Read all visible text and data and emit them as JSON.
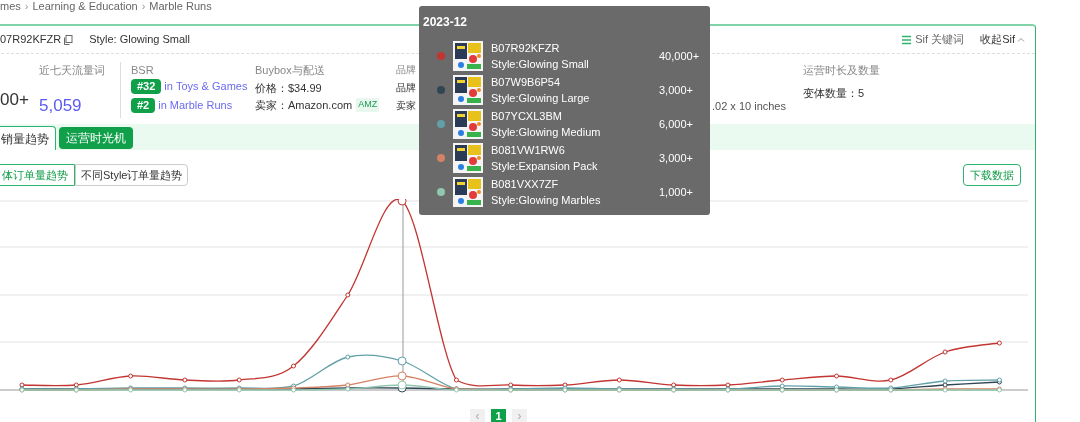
{
  "breadcrumb": {
    "separator": "›",
    "items": [
      "mes",
      "Learning & Education",
      "Marble Runs"
    ]
  },
  "header": {
    "asin": "07R92KFZR",
    "style": "Style: Glowing Small",
    "sif_keywords": "Sif 关键词",
    "collapse": "收起Sif"
  },
  "stats": {
    "sales_value": "00+",
    "traffic_label": "近七天流量词",
    "traffic_value": "5,059",
    "bsr_label": "BSR",
    "bsr": [
      {
        "rank": "#32",
        "prefix": "in",
        "category": "Toys & Games"
      },
      {
        "rank": "#2",
        "prefix": "in",
        "category": "Marble Runs"
      }
    ],
    "buybox_label": "Buybox与配送",
    "price": "价格：$34.99",
    "seller": "卖家：Amazon.com",
    "seller_badge": "AMZ",
    "brand_label": "品牌",
    "brand": "品牌",
    "seller_count": "卖家",
    "size_tail": ".02 x 10 inches",
    "ops_label": "运营时长及数量",
    "variants": "变体数量：5"
  },
  "tabs": [
    {
      "label": "销量趋势",
      "selected": true
    },
    {
      "label": "运营时光机",
      "selected": false
    }
  ],
  "sub_tabs": [
    {
      "label": "体订单量趋势",
      "selected": true
    },
    {
      "label": "不同Style订单量趋势",
      "selected": false
    }
  ],
  "download": "下载数据",
  "tooltip": {
    "title": "2023-12",
    "rows": [
      {
        "asin": "B07R92KFZR",
        "style": "Style:Glowing Small",
        "value": "40,000+",
        "color": "#c23531"
      },
      {
        "asin": "B07W9B6P54",
        "style": "Style:Glowing Large",
        "value": "3,000+",
        "color": "#2f4554"
      },
      {
        "asin": "B07YCXL3BM",
        "style": "Style:Glowing Medium",
        "value": "6,000+",
        "color": "#61a0a8"
      },
      {
        "asin": "B081VW1RW6",
        "style": "Style:Expansion Pack",
        "value": "3,000+",
        "color": "#d48265"
      },
      {
        "asin": "B081VXX7ZF",
        "style": "Style:Glowing Marbles",
        "value": "1,000+",
        "color": "#91c7ae"
      }
    ]
  },
  "pagination": {
    "prev": "‹",
    "pages": [
      {
        "label": "1",
        "selected": true
      }
    ],
    "next": "›"
  }
}
